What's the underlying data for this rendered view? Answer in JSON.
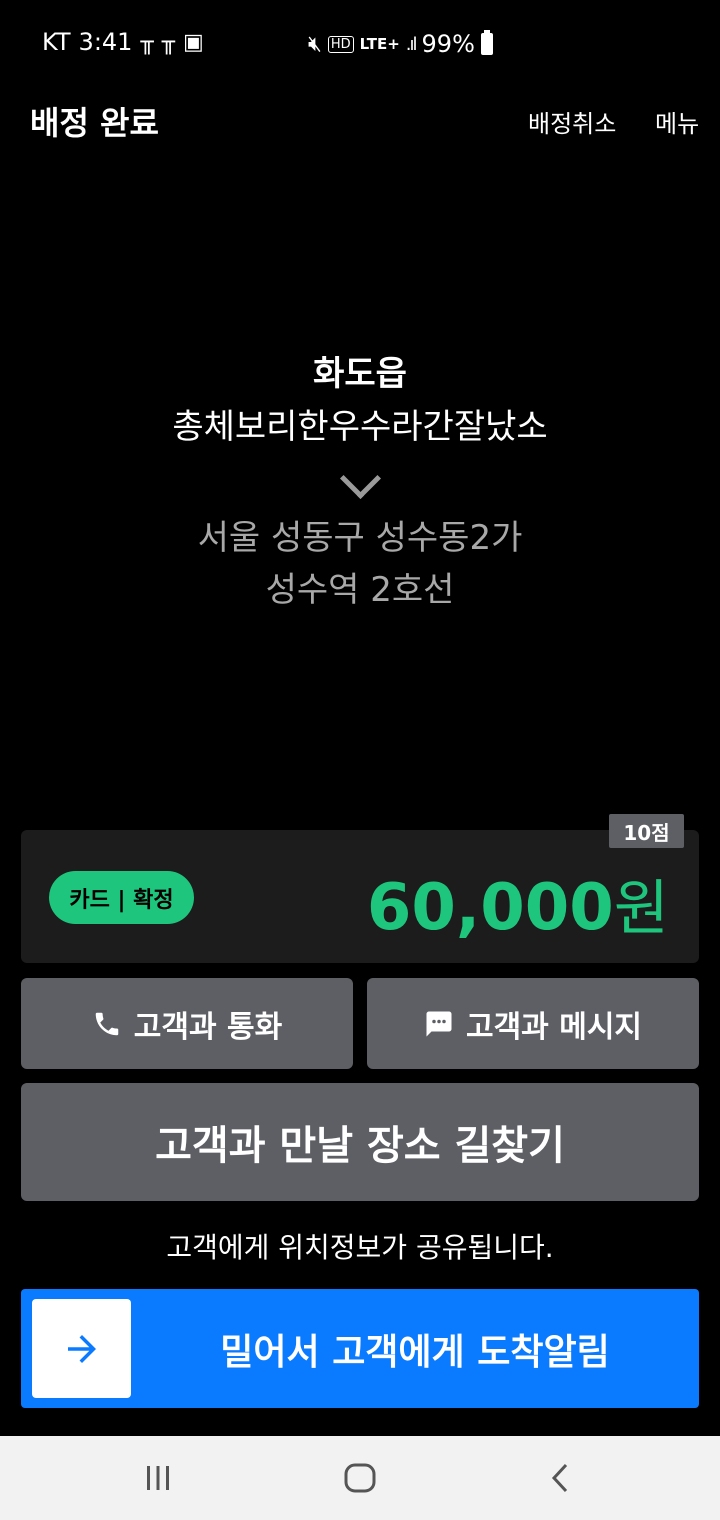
{
  "status_bar": {
    "carrier": "KT",
    "time": "3:41",
    "network": "LTE+",
    "battery": "99%"
  },
  "header": {
    "title": "배정 완료",
    "cancel_label": "배정취소",
    "menu_label": "메뉴"
  },
  "route": {
    "pickup_area": "화도읍",
    "pickup_name": "총체보리한우수라간잘났소",
    "dest_line1": "서울 성동구 성수동2가",
    "dest_line2": "성수역 2호선"
  },
  "fare": {
    "score": "10점",
    "payment": "카드 | 확정",
    "amount": "60,000",
    "unit": "원"
  },
  "actions": {
    "call_label": "고객과 통화",
    "message_label": "고객과 메시지",
    "navigate_label": "고객과 만날 장소 길찾기",
    "share_note": "고객에게 위치정보가 공유됩니다.",
    "slide_label": "밀어서 고객에게 도착알림"
  },
  "colors": {
    "accent_green": "#1ec67d",
    "slide_blue": "#0a7bff",
    "button_gray": "#5e5f64"
  },
  "icons": [
    "phone-icon",
    "message-icon",
    "arrow-right-icon",
    "recents-icon",
    "home-icon",
    "back-icon"
  ]
}
